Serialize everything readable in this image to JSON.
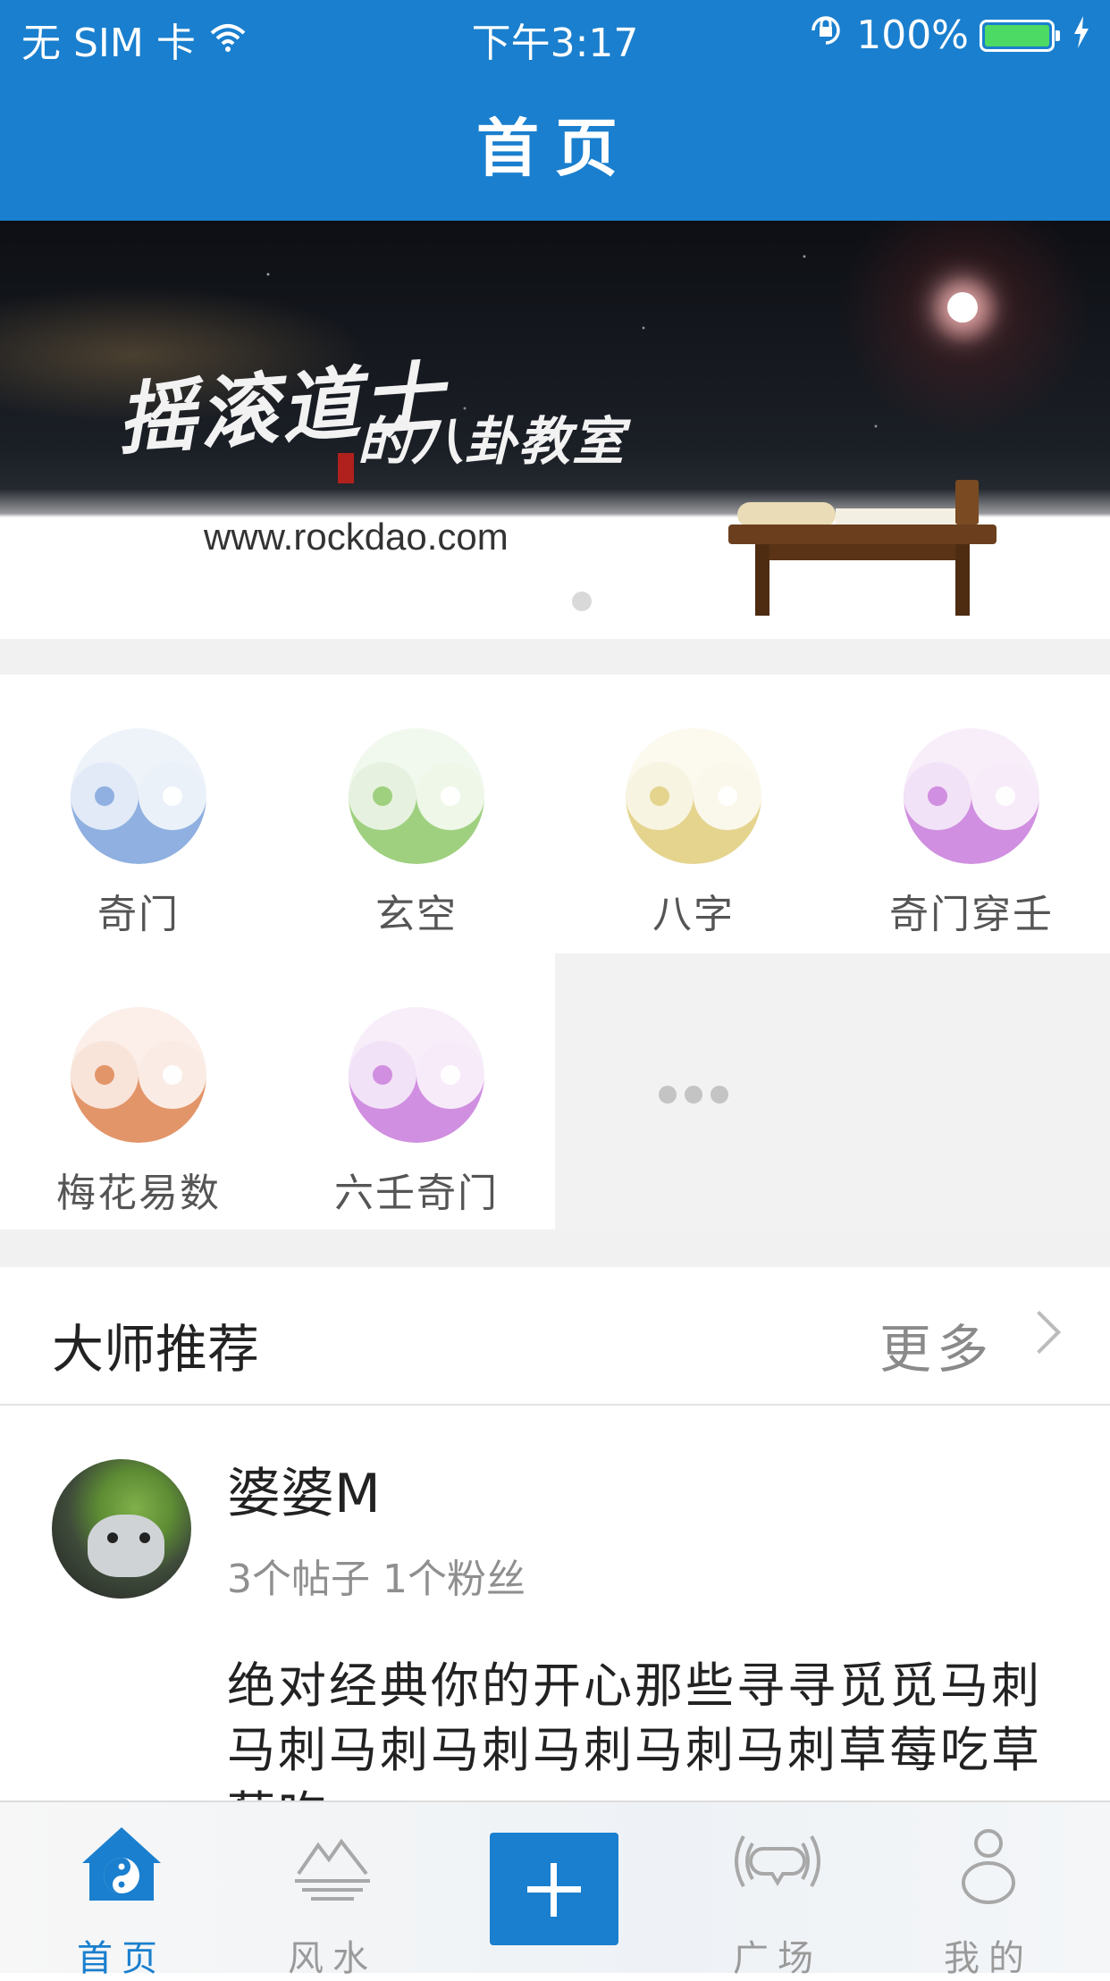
{
  "status_bar": {
    "carrier": "无 SIM 卡",
    "time": "下午3:17",
    "battery": "100%",
    "icons": [
      "wifi-icon",
      "rotation-lock-icon",
      "battery-icon",
      "charging-bolt-icon"
    ]
  },
  "nav": {
    "title": "首页"
  },
  "banner": {
    "headline_1": "摇滚道士",
    "headline_2": "的八卦教室",
    "url": "www.rockdao.com",
    "page_count": 1,
    "current_page": 1
  },
  "categories": [
    {
      "label": "奇门",
      "color": "#8fb0e0"
    },
    {
      "label": "玄空",
      "color": "#9fd080"
    },
    {
      "label": "八字",
      "color": "#e4d48e"
    },
    {
      "label": "奇门穿壬",
      "color": "#d08fe0"
    },
    {
      "label": "梅花易数",
      "color": "#e3956a"
    },
    {
      "label": "六壬奇门",
      "color": "#d08fe0"
    }
  ],
  "more_icon": "ellipsis-icon",
  "masters_section": {
    "title": "大师推荐",
    "more_label": "更多",
    "items": [
      {
        "name": "婆婆M",
        "stats": "3个帖子 1个粉丝",
        "description": "绝对经典你的开心那些寻寻觅觅马刺马刺马刺马刺马刺马刺马刺草莓吃草莓吃"
      }
    ]
  },
  "tabbar": {
    "tabs": [
      {
        "label": "首页",
        "icon": "home-yinyang-icon",
        "active": true
      },
      {
        "label": "风水",
        "icon": "mountain-water-icon",
        "active": false
      },
      {
        "label": "",
        "icon": "plus-icon",
        "active": false
      },
      {
        "label": "广场",
        "icon": "broadcast-icon",
        "active": false
      },
      {
        "label": "我的",
        "icon": "person-icon",
        "active": false
      }
    ]
  },
  "colors": {
    "brand": "#1a7fce",
    "muted_text": "#8f8f8f"
  }
}
